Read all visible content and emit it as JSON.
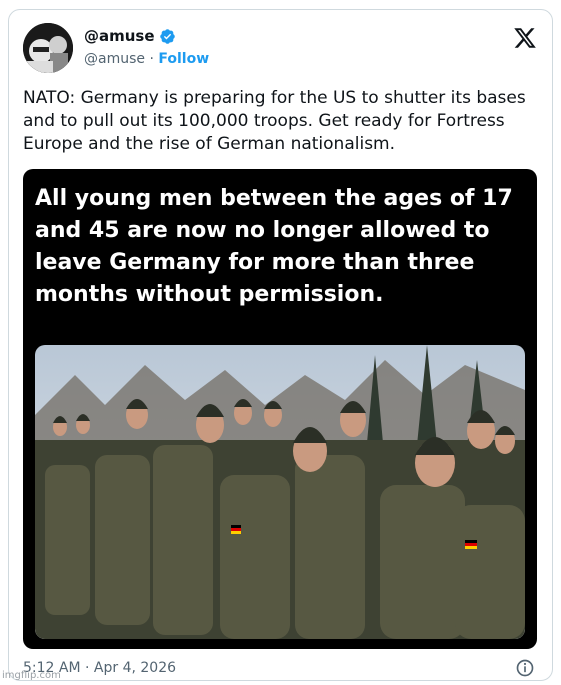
{
  "author": {
    "display_name": "@amuse",
    "handle": "@amuse",
    "separator": " · ",
    "follow_label": "Follow",
    "verified": true
  },
  "platform_icon": "x-logo-icon",
  "tweet": {
    "text": "NATO: Germany is preparing for the US to shutter its bases and to pull out its 100,000 troops. Get ready for Fortress Europe and the rise of German nationalism."
  },
  "media": {
    "caption": "All young men between the ages of 17 and 45 are now no longer allowed to leave Germany for more than three months without permission."
  },
  "footer": {
    "time": "5:12 AM",
    "separator": " · ",
    "date": "Apr 4, 2026"
  },
  "watermark": "imgflip.com",
  "colors": {
    "accent": "#1d9bf0",
    "text": "#0f1419",
    "muted": "#536471",
    "border": "#cfd9de"
  }
}
